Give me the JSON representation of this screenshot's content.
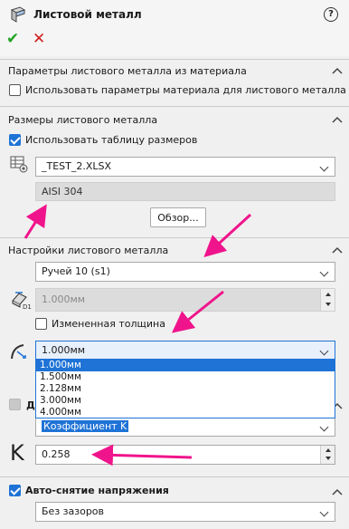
{
  "header": {
    "title": "Листовой металл",
    "help": "?",
    "ok": "✔",
    "cancel": "✕"
  },
  "material_section": {
    "title": "Параметры листового металла из материала",
    "checkbox_label": "Использовать параметры материала для листового металла",
    "checked": false
  },
  "size_section": {
    "title": "Размеры листового металла",
    "checkbox_label": "Использовать таблицу размеров",
    "checked": true,
    "table_file": "_TEST_2.XLSX",
    "material": "AISI 304",
    "browse": "Обзор..."
  },
  "settings_section": {
    "title": "Настройки листового металла",
    "groove": "Ручей 10 (s1)",
    "thickness": "1.000мм",
    "changed_thickness_label": "Измененная толщина",
    "changed_thickness_checked": false,
    "radius_value": "1.000мм",
    "radius_options": [
      "1.000мм",
      "1.500мм",
      "2.128мм",
      "3.000мм",
      "4.000мм"
    ],
    "radius_selected_index": 0,
    "allowance_partial_title": "До",
    "allowance_type": "Коэффициент K",
    "k_symbol": "K",
    "k_value": "0.258"
  },
  "relief_section": {
    "title": "Авто-снятие напряжения",
    "checked": true,
    "relief_type": "Без зазоров"
  },
  "colors": {
    "accent": "#1f73d6",
    "annotation_arrow": "#f0148c",
    "ok": "#23a323",
    "cancel": "#d12020"
  }
}
